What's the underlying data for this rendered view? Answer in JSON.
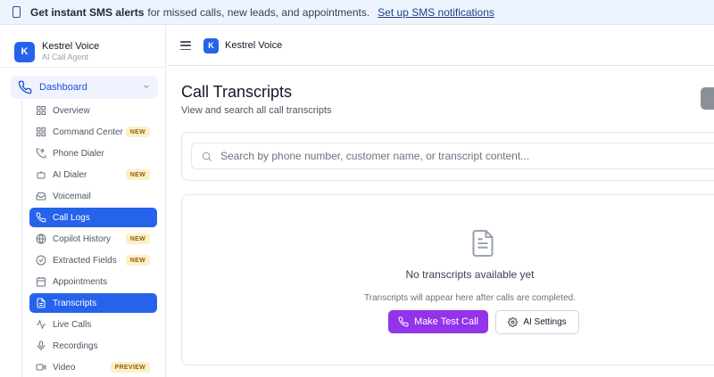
{
  "banner": {
    "bold": "Get instant SMS alerts",
    "text": "for missed calls, new leads, and appointments.",
    "link": "Set up SMS notifications"
  },
  "sidebar": {
    "brand_initial": "K",
    "brand_name": "Kestrel Voice",
    "brand_sub": "AI Call Agent",
    "section": "Dashboard",
    "items": [
      {
        "label": "Overview",
        "icon": "grid-icon",
        "badge": ""
      },
      {
        "label": "Command Center",
        "icon": "grid-icon",
        "badge": "NEW"
      },
      {
        "label": "Phone Dialer",
        "icon": "phone-forward-icon",
        "badge": ""
      },
      {
        "label": "AI Dialer",
        "icon": "bot-icon",
        "badge": "NEW"
      },
      {
        "label": "Voicemail",
        "icon": "inbox-icon",
        "badge": ""
      },
      {
        "label": "Call Logs",
        "icon": "phone-icon",
        "badge": "",
        "active": true
      },
      {
        "label": "Copilot History",
        "icon": "globe-icon",
        "badge": "NEW"
      },
      {
        "label": "Extracted Fields",
        "icon": "check-circle-icon",
        "badge": "NEW"
      },
      {
        "label": "Appointments",
        "icon": "calendar-icon",
        "badge": ""
      },
      {
        "label": "Transcripts",
        "icon": "document-icon",
        "badge": "",
        "active": true
      },
      {
        "label": "Live Calls",
        "icon": "activity-icon",
        "badge": ""
      },
      {
        "label": "Recordings",
        "icon": "mic-icon",
        "badge": ""
      },
      {
        "label": "Video",
        "icon": "video-icon",
        "badge": "PREVIEW"
      }
    ]
  },
  "header": {
    "logo_initial": "K",
    "title": "Kestrel Voice"
  },
  "main": {
    "title": "Call Transcripts",
    "subtitle": "View and search all call transcripts",
    "search_placeholder": "Search by phone number, customer name, or transcript content...",
    "empty_title": "No transcripts available yet",
    "empty_subtitle": "Transcripts will appear here after calls are completed.",
    "primary_button": "Make Test Call",
    "secondary_button": "AI Settings"
  },
  "colors": {
    "primary": "#2563eb",
    "accent_purple": "#9333ea",
    "badge_bg": "#fdf0c8",
    "banner_bg": "#eef4fd"
  }
}
